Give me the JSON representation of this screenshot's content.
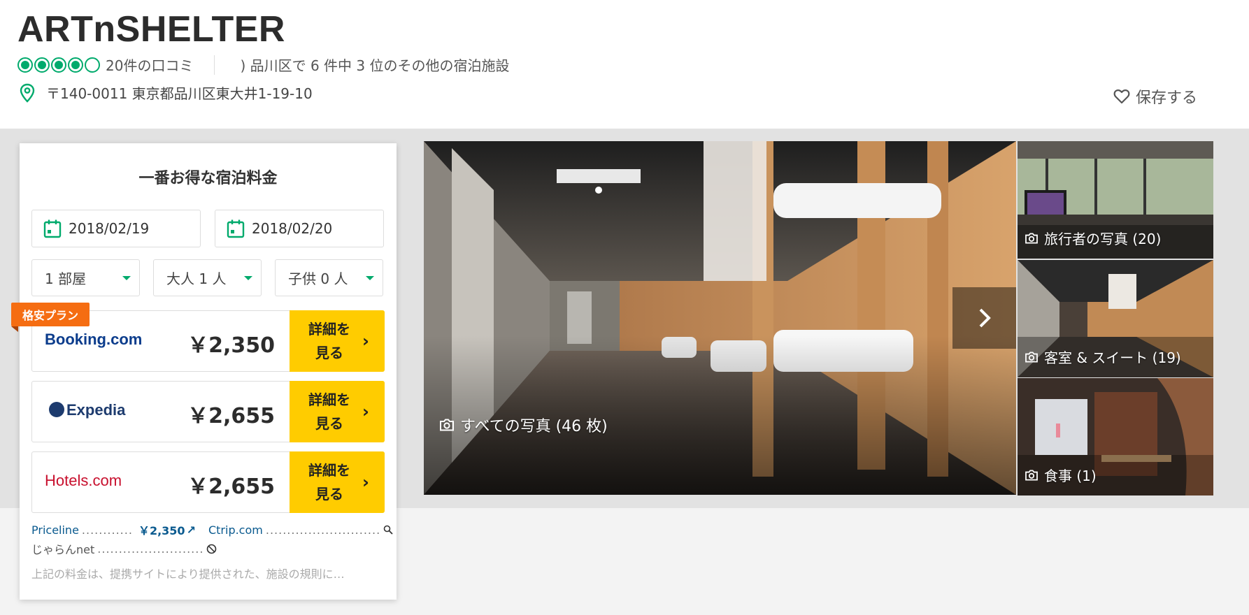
{
  "header": {
    "title": "ARTnSHELTER",
    "rating": 4,
    "rating_max": 5,
    "reviews": "20件の口コミ",
    "ranking": ") 品川区で 6 件中 3 位のその他の宿泊施設",
    "address": "〒140-0011 東京都品川区東大井1-19-10",
    "save_label": "保存する"
  },
  "booking": {
    "title": "一番お得な宿泊料金",
    "checkin": "2018/02/19",
    "checkout": "2018/02/20",
    "rooms": "1 部屋",
    "adults": "大人 1 人",
    "children": "子供 0 人",
    "deal_tag": "格安プラン",
    "offers": [
      {
        "provider": "Booking.com",
        "price": "￥2,350",
        "button": "詳細を見る"
      },
      {
        "provider": "Expedia",
        "price": "￥2,655",
        "button": "詳細を見る"
      },
      {
        "provider": "Hotels.com",
        "price": "￥2,655",
        "button": "詳細を見る"
      }
    ],
    "more": {
      "priceline": "Priceline",
      "priceline_price": "￥2,350",
      "ctrip": "Ctrip.com",
      "jalan": "じゃらんnet"
    },
    "disclaimer": "上記の料金は、提携サイトにより提供された、施設の規則に…"
  },
  "photos": {
    "all": "すべての写真 (46 枚)",
    "traveler": "旅行者の写真 (20)",
    "rooms": "客室 & スイート (19)",
    "dining": "食事 (1)"
  },
  "colors": {
    "accent": "#00aa6c",
    "button": "#ffcc00",
    "deal": "#f56d12",
    "link": "#0a5a8f"
  }
}
